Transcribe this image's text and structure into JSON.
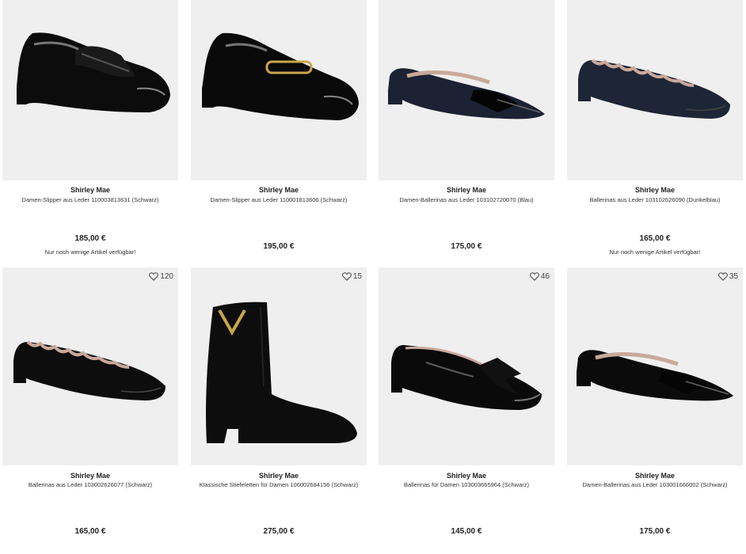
{
  "products": [
    {
      "brand": "Shirley Mae",
      "name": "Damen-Slipper aus Leder 110003813631 (Schwarz)",
      "price": "185,00 €",
      "note": "Nur noch wenige Artikel verfügbar!",
      "favorites": "",
      "color": "#0c0c0c",
      "style": "loafer-fringe"
    },
    {
      "brand": "Shirley Mae",
      "name": "Damen-Slipper aus Leder 110001813606 (Schwarz)",
      "price": "195,00 €",
      "note": "",
      "favorites": "",
      "color": "#0a0a0a",
      "style": "loafer-buckle"
    },
    {
      "brand": "Shirley Mae",
      "name": "Damen-Ballerinas aus Leder 103102720070 (Blau)",
      "price": "175,00 €",
      "note": "",
      "favorites": "",
      "color": "#1c2234",
      "style": "ballerina-pointed"
    },
    {
      "brand": "Shirley Mae",
      "name": "Ballerinas aus Leder 103102626090 (Dunkelblau)",
      "price": "165,00 €",
      "note": "Nur noch wenige Artikel verfügbar!",
      "favorites": "",
      "color": "#1e2536",
      "style": "ballerina-scallop"
    },
    {
      "brand": "Shirley Mae",
      "name": "Ballerinas aus Leder 103002626077 (Schwarz)",
      "price": "165,00 €",
      "note": "",
      "favorites": "120",
      "color": "#0d0d0d",
      "style": "ballerina-scallop"
    },
    {
      "brand": "Shirley Mae",
      "name": "Klassische Stiefeletten für Damen 106002684156 (Schwarz)",
      "price": "275,00 €",
      "note": "",
      "favorites": "15",
      "color": "#0d0d0d",
      "style": "bootie"
    },
    {
      "brand": "Shirley Mae",
      "name": "Ballerinas für Damen 103003665964 (Schwarz)",
      "price": "145,00 €",
      "note": "",
      "favorites": "46",
      "color": "#0a0a0a",
      "style": "ballerina-bow"
    },
    {
      "brand": "Shirley Mae",
      "name": "Damen-Ballerinas aus Leder 103001666002 (Schwarz)",
      "price": "175,00 €",
      "note": "",
      "favorites": "35",
      "color": "#0b0b0b",
      "style": "ballerina-pointed"
    }
  ]
}
